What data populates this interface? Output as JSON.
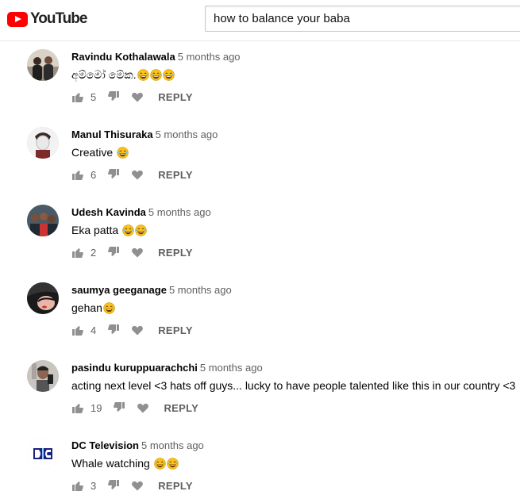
{
  "header": {
    "logo_text": "YouTube",
    "search_value": "how to balance your baba"
  },
  "colors": {
    "brand": "#ff0000",
    "meta": "#606060",
    "icon": "#909090"
  },
  "comments": [
    {
      "author": "Ravindu Kothalawala",
      "time": "5 months ago",
      "text": "අම්මෝ මේක.",
      "emoji_count": 3,
      "likes": "5",
      "reply_label": "REPLY",
      "avatar": "photo-two-people"
    },
    {
      "author": "Manul Thisuraka",
      "time": "5 months ago",
      "text": "Creative ",
      "emoji_count": 1,
      "likes": "6",
      "reply_label": "REPLY",
      "avatar": "photo-person-white-face"
    },
    {
      "author": "Udesh Kavinda",
      "time": "5 months ago",
      "text": "Eka patta ",
      "emoji_count": 2,
      "likes": "2",
      "reply_label": "REPLY",
      "avatar": "photo-group"
    },
    {
      "author": "saumya geeganage",
      "time": "5 months ago",
      "text": "gehan",
      "emoji_count": 1,
      "likes": "4",
      "reply_label": "REPLY",
      "avatar": "photo-face-dark"
    },
    {
      "author": "pasindu kuruppuarachchi",
      "time": "5 months ago",
      "text": "acting next level <3 hats off guys... lucky to have people talented like this in our country <3",
      "emoji_count": 0,
      "likes": "19",
      "reply_label": "REPLY",
      "avatar": "photo-selfie"
    },
    {
      "author": "DC Television",
      "time": "5 months ago",
      "text": "Whale watching ",
      "emoji_count": 2,
      "likes": "3",
      "reply_label": "REPLY",
      "avatar": "dc-logo"
    }
  ]
}
